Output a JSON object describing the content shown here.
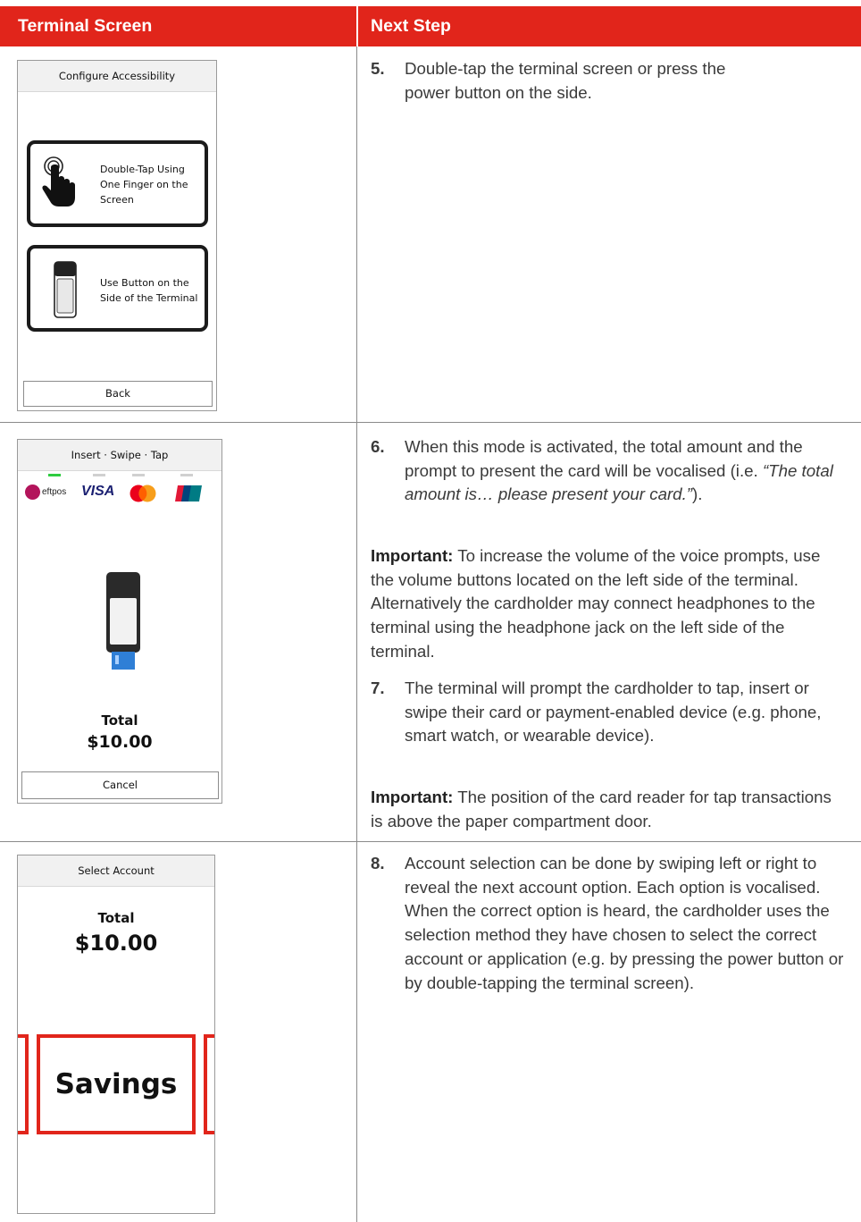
{
  "header": {
    "col1": "Terminal Screen",
    "col2": "Next Step",
    "color": "#e1251b"
  },
  "row1": {
    "screen": {
      "title": "Configure Accessibility",
      "option1": "Double-Tap Using One Finger on the Screen",
      "option2": "Use Button on the Side of the Terminal",
      "back": "Back"
    },
    "step_num": "5.",
    "step_text": "Double-tap the terminal screen or press the power button on the side."
  },
  "row2": {
    "screen": {
      "title": "Insert · Swipe · Tap",
      "logo_eftpos": "eftpos",
      "logo_visa": "VISA",
      "total_label": "Total",
      "total_amount": "$10.00",
      "cancel": "Cancel"
    },
    "step6_num": "6.",
    "step6_text_a": "When this mode is activated, the total amount and the prompt to present the card will be vocalised (i.e. ",
    "step6_quote": "“The total amount is… please present your card.”",
    "step6_text_b": ").",
    "important1_label": "Important:",
    "important1_text": " To increase the volume of the voice prompts, use the volume buttons located on the left side of the terminal. Alternatively the cardholder may connect headphones to the terminal using the headphone jack on the left side of the terminal.",
    "step7_num": "7.",
    "step7_text": "The terminal will prompt the cardholder to tap, insert or swipe their card or payment-enabled device (e.g. phone, smart watch, or wearable device).",
    "important2_label": "Important:",
    "important2_text": " The position of the card reader for tap transactions is above the paper compartment door."
  },
  "row3": {
    "screen": {
      "title": "Select Account",
      "total_label": "Total",
      "total_amount": "$10.00",
      "account": "Savings"
    },
    "step_num": "8.",
    "step_text": "Account selection can be done by swiping left or right to reveal the next account option. Each option is vocalised. When the correct option is heard, the cardholder uses the selection method they have chosen to select the correct account or application (e.g. by pressing the power button or by double-tapping the terminal screen)."
  }
}
